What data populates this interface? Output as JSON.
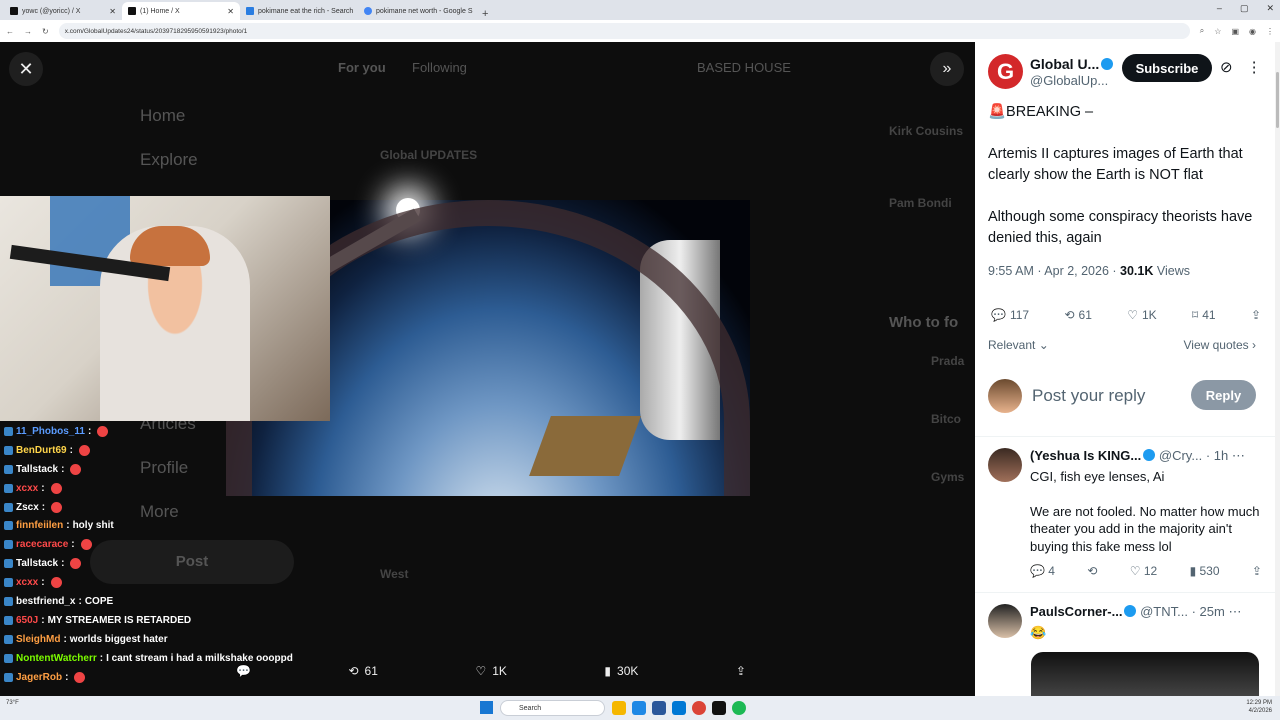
{
  "browser": {
    "tabs": [
      {
        "label": "yowc (@yoricc) / X"
      },
      {
        "label": "(1) Home / X"
      },
      {
        "label": "pokimane eat the rich - Search"
      },
      {
        "label": "pokimane net worth - Google S"
      }
    ],
    "new_tab": "+",
    "url": "x.com/GlobalUpdates24/status/2039718295950591923/photo/1"
  },
  "background": {
    "nav_home": "Home",
    "nav_explore": "Explore",
    "nav_articles": "Articles",
    "nav_profile": "Profile",
    "nav_more": "More",
    "post_button": "Post",
    "tab_for_you": "For you",
    "tab_following": "Following",
    "tab_4": "BASED HOUSE",
    "feed_author": "Global UPDATES",
    "feed_breaking": "BREAKING –",
    "feed_author2": "West",
    "who_to_follow": "Who to fo",
    "trend1": "Kirk Cousins",
    "trend2": "Pam Bondi",
    "follow1": "Prada",
    "follow2": "Bitco",
    "follow3": "Gyms"
  },
  "chat": [
    {
      "user": "11_Phobos_11",
      "msg": "",
      "color": "#5b9cff"
    },
    {
      "user": "BenDurt69",
      "msg": "",
      "color": "#ffd54a"
    },
    {
      "user": "Tallstack",
      "msg": "",
      "color": "#ffffff"
    },
    {
      "user": "xcxx",
      "msg": "",
      "color": "#ff4a4a"
    },
    {
      "user": "Zscx",
      "msg": "",
      "color": "#ffffff"
    },
    {
      "user": "finnfeiilen",
      "msg": "holy shit",
      "color": "#ff9f43"
    },
    {
      "user": "racecarace",
      "msg": "",
      "color": "#ff4a4a"
    },
    {
      "user": "Tallstack",
      "msg": "",
      "color": "#ffffff"
    },
    {
      "user": "xcxx",
      "msg": "",
      "color": "#ff4a4a"
    },
    {
      "user": "bestfriend_x",
      "msg": "COPE",
      "color": "#ffffff"
    },
    {
      "user": "650J",
      "msg": "MY STREAMER IS RETARDED",
      "color": "#ff4a4a"
    },
    {
      "user": "SleighMd",
      "msg": "worlds biggest hater",
      "color": "#ff9f43"
    },
    {
      "user": "NontentWatcherr",
      "msg": "I cant stream i had a milkshake oooppd",
      "color": "#7cfc00"
    },
    {
      "user": "JagerRob",
      "msg": "",
      "color": "#ff9f43"
    }
  ],
  "media_bar": {
    "retweets": "61",
    "likes": "1K",
    "views": "30K"
  },
  "post": {
    "author_name": "Global U...",
    "author_handle": "@GlobalUp...",
    "subscribe": "Subscribe",
    "line1": "🚨BREAKING –",
    "line2": "Artemis II captures images of Earth that clearly show the Earth is NOT flat",
    "line3": "Although some conspiracy theorists have denied this, again",
    "timestamp": "9:55 AM · Apr 2, 2026 · ",
    "views_count": "30.1K",
    "views_label": " Views",
    "replies": "117",
    "reposts": "61",
    "likes": "1K",
    "bookmarks": "41",
    "sort": "Relevant",
    "view_quotes": "View quotes",
    "reply_placeholder": "Post your reply",
    "reply_button": "Reply"
  },
  "replies": [
    {
      "name": "(Yeshua Is KING...",
      "handle": "@Cry...",
      "time": "· 1h",
      "text1": "CGI, fish eye lenses, Ai",
      "text2": "We are not fooled. No matter how much theater you add in the majority ain't buying this fake mess lol",
      "replies": "4",
      "likes": "12",
      "views": "530"
    },
    {
      "name": "PaulsCorner-...",
      "handle": "@TNT...",
      "time": "· 25m",
      "text1": "😂"
    }
  ],
  "taskbar": {
    "search": "Search",
    "time": "12:29 PM",
    "date": "4/2/2026",
    "weather": "73°F"
  }
}
